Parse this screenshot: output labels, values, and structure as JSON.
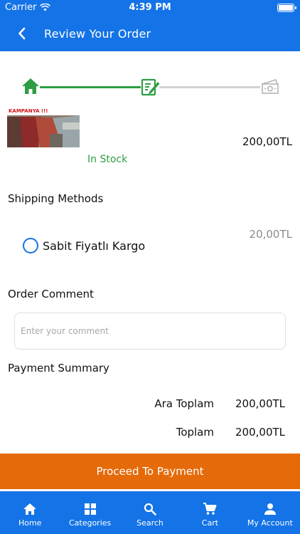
{
  "status_bar": {
    "carrier": "Carrier",
    "time": "4:39 PM"
  },
  "header": {
    "title": "Review Your Order"
  },
  "product": {
    "image_text": "KAMPANYA !!!",
    "price": "200,00TL",
    "stock": "In Stock"
  },
  "shipping": {
    "title": "Shipping Methods",
    "method": "Sabit Fiyatlı Kargo",
    "price": "20,00TL"
  },
  "comment": {
    "title": "Order Comment",
    "placeholder": "Enter your comment"
  },
  "summary": {
    "title": "Payment Summary",
    "rows": [
      {
        "label": "Ara Toplam",
        "value": "200,00TL"
      },
      {
        "label": "Toplam",
        "value": "200,00TL"
      }
    ]
  },
  "proceed_label": "Proceed To Payment",
  "colors": {
    "primary": "#1473e6",
    "accent": "#e56a0a",
    "success": "#2e9e43"
  },
  "tabs": [
    {
      "label": "Home",
      "icon": "home-icon"
    },
    {
      "label": "Categories",
      "icon": "grid-icon"
    },
    {
      "label": "Search",
      "icon": "search-icon"
    },
    {
      "label": "Cart",
      "icon": "cart-icon"
    },
    {
      "label": "My Account",
      "icon": "person-icon"
    }
  ]
}
